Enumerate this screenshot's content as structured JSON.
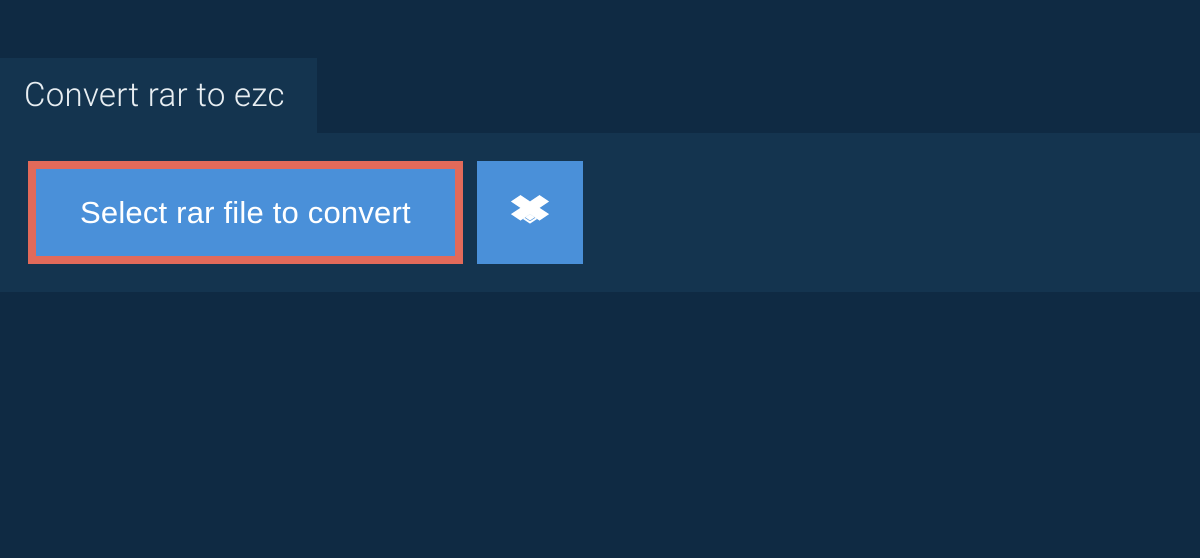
{
  "tab": {
    "title": "Convert rar to ezc"
  },
  "actions": {
    "select_file_label": "Select rar file to convert"
  }
}
